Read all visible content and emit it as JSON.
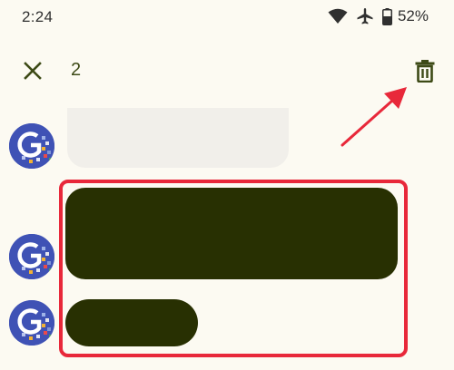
{
  "status_bar": {
    "time": "2:24",
    "battery": "52%",
    "icons": [
      "wifi-icon",
      "airplane-icon",
      "battery-icon"
    ]
  },
  "action_bar": {
    "selected_count": "2",
    "close_icon": "close-icon",
    "delete_icon": "trash-icon"
  },
  "messages": [
    {
      "style": "received-light",
      "selected": false
    },
    {
      "style": "received-dark",
      "selected": true
    },
    {
      "style": "received-dark",
      "selected": true
    }
  ],
  "colors": {
    "background": "#fcfaf2",
    "accent": "#3d4a16",
    "selected_bubble": "#283002",
    "unselected_bubble": "#f1efea",
    "annotation": "#e8283a",
    "avatar": "#3f52b5"
  }
}
